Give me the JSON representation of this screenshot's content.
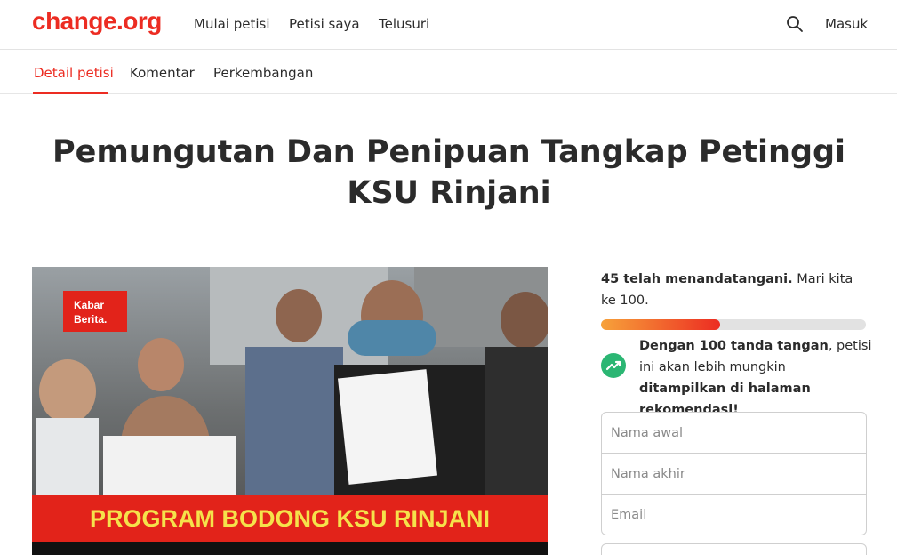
{
  "header": {
    "logo": "change.org",
    "nav": [
      "Mulai petisi",
      "Petisi saya",
      "Telusuri"
    ],
    "login": "Masuk"
  },
  "tabs": [
    "Detail petisi",
    "Komentar",
    "Perkembangan"
  ],
  "petition": {
    "title": "Pemungutan Dan Penipuan Tangkap Petinggi KSU Rinjani",
    "image": {
      "badge": "Kabar Berita.",
      "banner": "PROGRAM BODONG KSU RINJANI"
    }
  },
  "signatures": {
    "count_text": "45 telah menandatangani.",
    "goal_text": "Mari kita ke 100.",
    "progress": 0.45,
    "promo_bold1": "Dengan 100 tanda tangan",
    "promo_mid": ", petisi ini akan lebih mungkin",
    "promo_bold2": "ditampilkan di halaman rekomendasi!"
  },
  "form": {
    "first_name_placeholder": "Nama awal",
    "last_name_placeholder": "Nama akhir",
    "email_placeholder": "Email"
  },
  "colors": {
    "brand": "#ec2c22",
    "progress_start": "#f7a23a",
    "trend_green": "#2bb673"
  }
}
